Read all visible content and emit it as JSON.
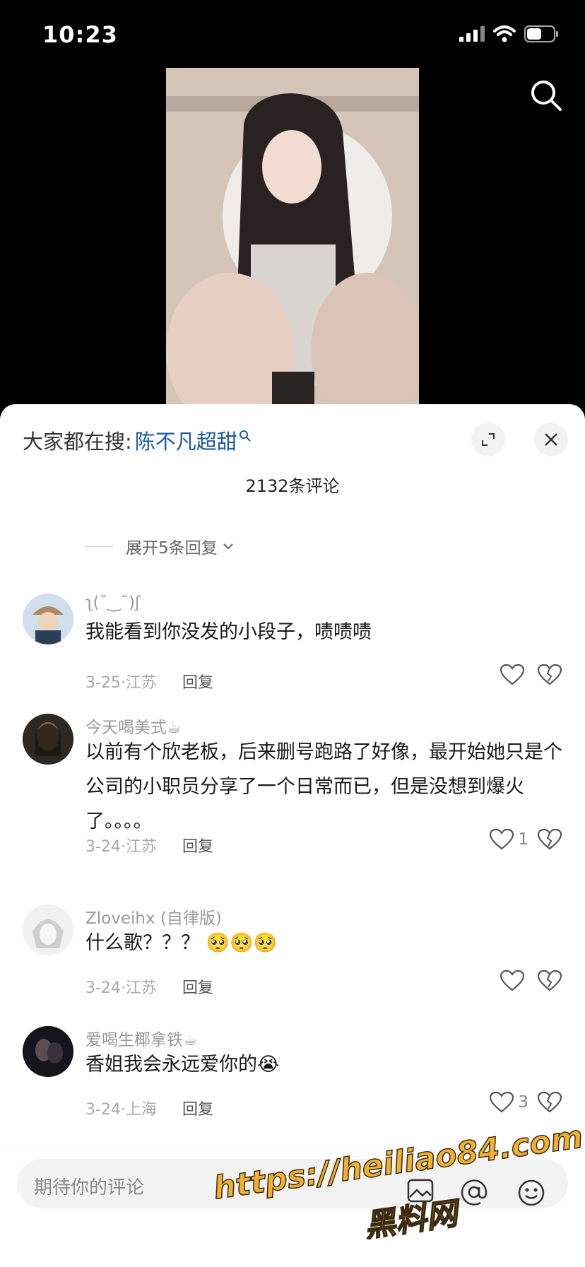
{
  "status": {
    "time": "10:23"
  },
  "hot_search": {
    "prefix": "大家都在搜:",
    "term": "陈不凡超甜"
  },
  "comments_count": "2132条评论",
  "expand": {
    "label": "展开5条回复"
  },
  "comments": [
    {
      "name": "ʅ(˘‿˘)ʃ",
      "text": "我能看到你没发的小段子，啧啧啧",
      "date": "3-25·江苏",
      "reply": "回复",
      "likes": ""
    },
    {
      "name": "今天喝美式☕",
      "text": "以前有个欣老板，后来删号跑路了好像，最开始她只是个公司的小职员分享了一个日常而已，但是没想到爆火了。。。。",
      "date": "3-24·江苏",
      "reply": "回复",
      "likes": "1"
    },
    {
      "name": "Zloveihx (自律版)",
      "text": "什么歌？？？ 🥺🥺🥺",
      "date": "3-24·江苏",
      "reply": "回复",
      "likes": ""
    },
    {
      "name": "爱喝生椰拿铁☕",
      "text": "香姐我会永远爱你的😭",
      "date": "3-24·上海",
      "reply": "回复",
      "likes": "3"
    }
  ],
  "input": {
    "placeholder": "期待你的评论"
  },
  "watermark": {
    "url": "https://heiliao84.com",
    "name": "黑料网"
  },
  "colors": {
    "accent_link": "#1a5aa8",
    "watermark": "#f2b030"
  }
}
